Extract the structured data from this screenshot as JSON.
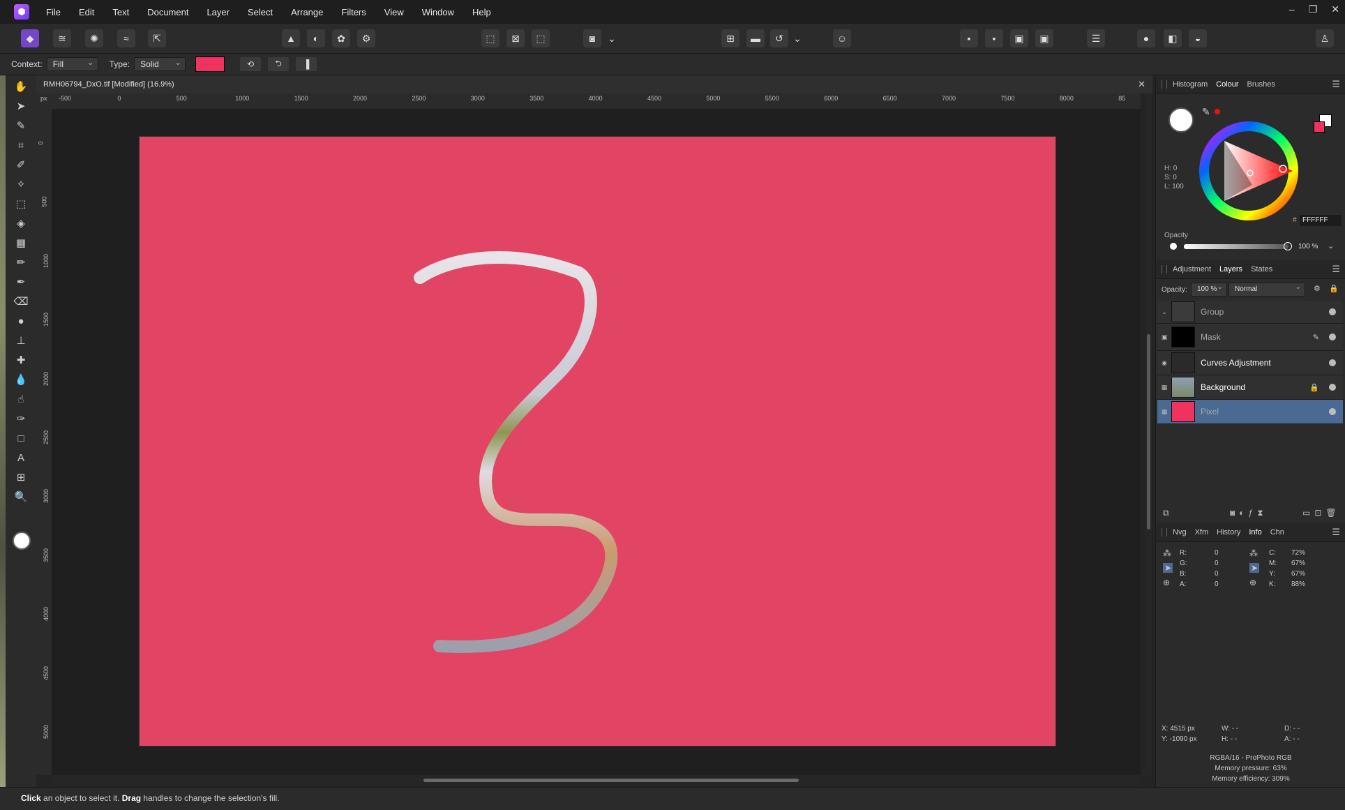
{
  "menubar": {
    "items": [
      "File",
      "Edit",
      "Text",
      "Document",
      "Layer",
      "Select",
      "Arrange",
      "Filters",
      "View",
      "Window",
      "Help"
    ],
    "window_controls": [
      "–",
      "❐",
      "✕"
    ]
  },
  "context": {
    "context_label": "Context:",
    "context_value": "Fill",
    "type_label": "Type:",
    "type_value": "Solid",
    "fill_color": "#f0325f"
  },
  "document": {
    "title": "RMH06794_DxO.tif [Modified] (16.9%)",
    "ruler_unit": "px",
    "ruler_h_labels": [
      "-500",
      "0",
      "500",
      "1000",
      "1500",
      "2000",
      "2500",
      "3000",
      "3500",
      "4000",
      "4500",
      "5000",
      "5500",
      "6000",
      "6500",
      "7000",
      "7500",
      "8000",
      "85"
    ],
    "ruler_v_labels": [
      "0",
      "500",
      "1000",
      "1500",
      "2000",
      "2500",
      "3000",
      "3500",
      "4000",
      "4500",
      "5000"
    ],
    "canvas_color": "#e24464"
  },
  "status": {
    "click": "Click",
    "text1": " an object to select it. ",
    "drag": "Drag",
    "text2": " handles to change the selection's fill."
  },
  "colour_panel": {
    "tabs": [
      "Histogram",
      "Colour",
      "Brushes"
    ],
    "active_tab": "Colour",
    "h": "H: 0",
    "s": "S: 0",
    "l": "L: 100",
    "hex_prefix": "#",
    "hex": "FFFFFF",
    "opacity_label": "Opacity",
    "opacity_value": "100 %"
  },
  "layers_panel": {
    "tabs": [
      "Adjustment",
      "Layers",
      "States"
    ],
    "active_tab": "Layers",
    "opacity_label": "Opacity:",
    "opacity_value": "100 %",
    "blend_mode": "Normal",
    "layers": [
      {
        "name": "Group"
      },
      {
        "name": "Mask"
      },
      {
        "name": "Curves Adjustment"
      },
      {
        "name": "Background"
      },
      {
        "name": "Pixel"
      }
    ]
  },
  "info_panel": {
    "tabs": [
      "Nvg",
      "Xfm",
      "History",
      "Info",
      "Chn"
    ],
    "active_tab": "Info",
    "rgba": [
      {
        "label": "R:",
        "value": "0"
      },
      {
        "label": "G:",
        "value": "0"
      },
      {
        "label": "B:",
        "value": "0"
      },
      {
        "label": "A:",
        "value": "0"
      }
    ],
    "cmyk": [
      {
        "label": "C:",
        "value": "72%"
      },
      {
        "label": "M:",
        "value": "67%"
      },
      {
        "label": "Y:",
        "value": "67%"
      },
      {
        "label": "K:",
        "value": "88%"
      }
    ],
    "x": "X: 4515 px",
    "y": "Y: -1090 px",
    "w": "W: - -",
    "h": "H: - -",
    "d": "D: - -",
    "a": "A: - -",
    "color_profile": "RGBA/16 - ProPhoto RGB",
    "memory_pressure": "Memory pressure: 63%",
    "memory_efficiency": "Memory efficiency: 309%"
  }
}
